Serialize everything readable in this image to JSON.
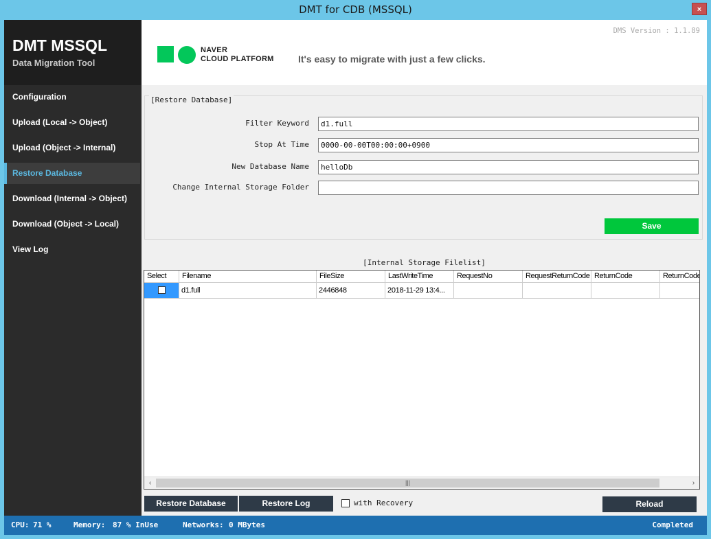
{
  "window": {
    "title": "DMT for CDB (MSSQL)",
    "close_glyph": "×"
  },
  "sidebar": {
    "brand_title": "DMT MSSQL",
    "brand_subtitle": "Data Migration Tool",
    "items": [
      {
        "label": "Configuration"
      },
      {
        "label": "Upload (Local -> Object)"
      },
      {
        "label": "Upload (Object -> Internal)"
      },
      {
        "label": "Restore Database",
        "active": true
      },
      {
        "label": "Download (Internal -> Object)"
      },
      {
        "label": "Download (Object -> Local)"
      },
      {
        "label": "View Log"
      }
    ]
  },
  "header": {
    "version": "DMS Version : 1.1.89",
    "logo_line1": "NAVER",
    "logo_line2": "CLOUD PLATFORM",
    "tagline": "It's easy to migrate with just a few clicks.",
    "brand_color": "#03c75a"
  },
  "restore_form": {
    "title": "[Restore Database]",
    "fields": [
      {
        "label": "Filter Keyword",
        "value": "d1.full"
      },
      {
        "label": "Stop At Time",
        "value": "0000-00-00T00:00:00+0900"
      },
      {
        "label": "New Database Name",
        "value": "helloDb"
      },
      {
        "label": "Change Internal Storage Folder",
        "value": ""
      }
    ],
    "save_label": "Save"
  },
  "filelist": {
    "title": "[Internal Storage Filelist]",
    "columns": [
      "Select",
      "Filename",
      "FileSize",
      "LastWriteTime",
      "RequestNo",
      "RequestReturnCode",
      "ReturnCode",
      "ReturnCode"
    ],
    "rows": [
      {
        "selected": false,
        "filename": "d1.full",
        "filesize": "2446848",
        "lastwritetime": "2018-11-29 13:4...",
        "requestno": "",
        "requestreturncode": "",
        "returncode": "",
        "returncode2": ""
      }
    ]
  },
  "actions": {
    "restore_database": "Restore Database",
    "restore_log": "Restore Log",
    "with_recovery": "with Recovery",
    "with_recovery_checked": false,
    "reload": "Reload"
  },
  "status": {
    "cpu_label": "CPU:",
    "cpu_value": "71 %",
    "memory_label": "Memory:",
    "memory_value": "87 % InUse",
    "networks_label": "Networks:",
    "networks_value": "0 MBytes",
    "state": "Completed"
  }
}
